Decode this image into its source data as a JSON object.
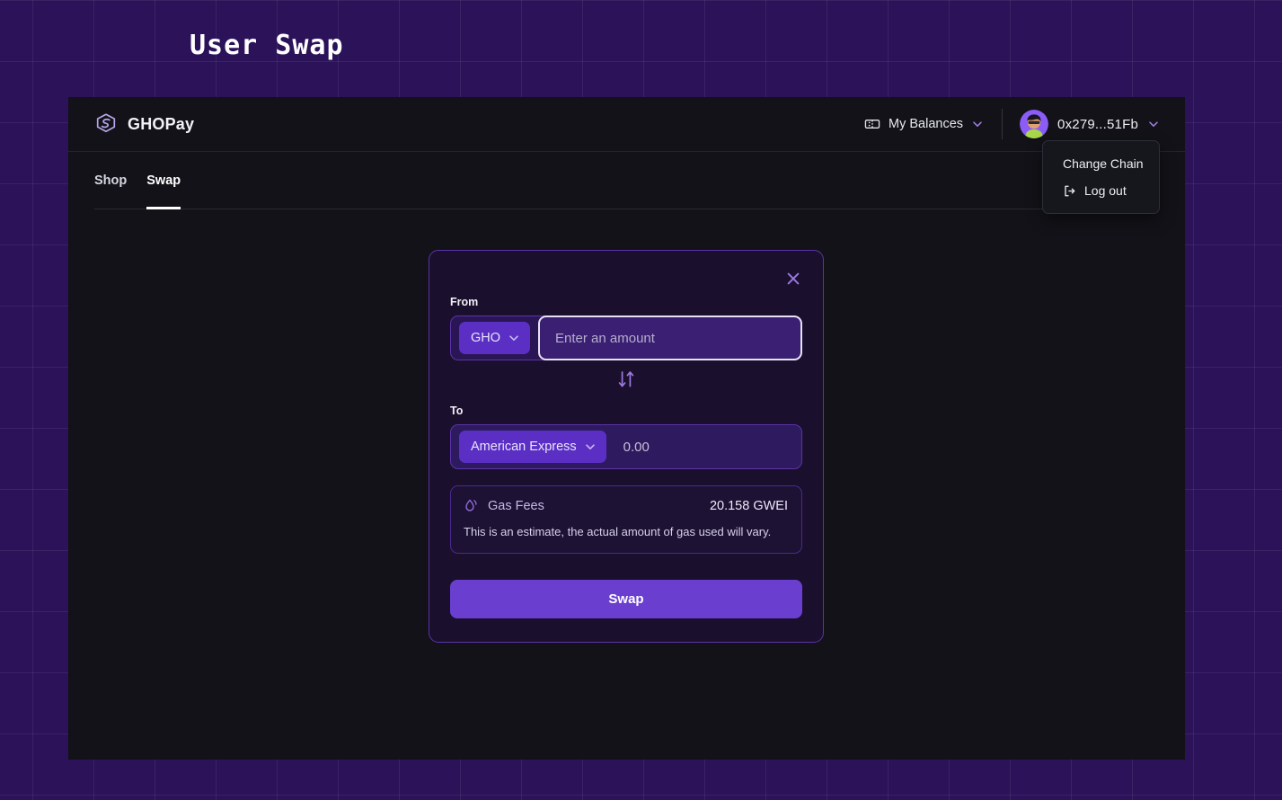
{
  "page": {
    "title": "User Swap"
  },
  "header": {
    "brand_name": "GHOPay",
    "brand_logo_icon": "ghopay-hexagon-logo",
    "balances_label": "My Balances",
    "balances_icon": "ticket-icon",
    "balances_chevron_icon": "chevron-down-icon",
    "account_address": "0x279...51Fb",
    "avatar_icon": "user-avatar",
    "account_chevron_icon": "chevron-down-icon"
  },
  "account_menu": {
    "items": [
      {
        "label": "Change Chain",
        "icon": ""
      },
      {
        "label": "Log out",
        "icon": "logout-icon"
      }
    ]
  },
  "tabs": [
    {
      "label": "Shop",
      "active": false
    },
    {
      "label": "Swap",
      "active": true
    }
  ],
  "swap_card": {
    "close_icon": "close-icon",
    "from": {
      "label": "From",
      "token": "GHO",
      "token_chevron_icon": "chevron-down-icon",
      "amount_value": "",
      "amount_placeholder": "Enter an amount"
    },
    "switch_icon": "swap-arrows-icon",
    "to": {
      "label": "To",
      "token": "American Express",
      "token_chevron_icon": "chevron-down-icon",
      "amount_value": "0.00"
    },
    "gas": {
      "icon": "droplet-icon",
      "label": "Gas Fees",
      "value": "20.158 GWEI",
      "note": "This is an estimate, the actual amount of gas used will vary."
    },
    "submit_label": "Swap"
  },
  "colors": {
    "page_background": "#2b1259",
    "app_background": "#121218",
    "card_background": "#1b0f2e",
    "card_border": "#5b33a8",
    "accent_purple": "#6a3fd0",
    "token_chip": "#5b2fc4",
    "input_focus_border": "#e6e2f2"
  }
}
